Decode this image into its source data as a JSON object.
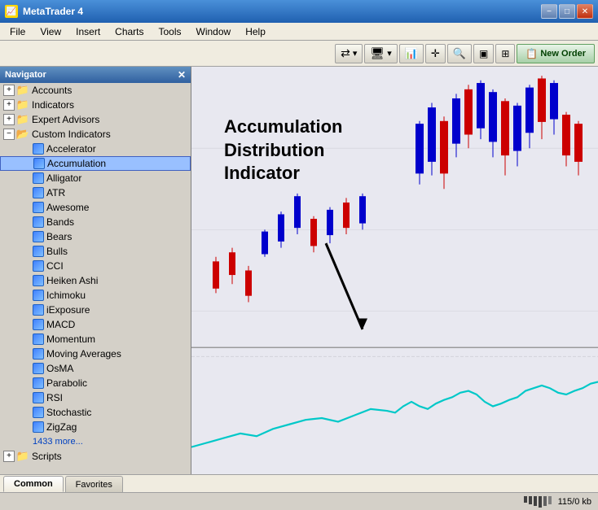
{
  "titleBar": {
    "title": "MetaTrader 4",
    "icon": "📈",
    "buttons": {
      "minimize": "−",
      "maximize": "□",
      "close": "✕"
    }
  },
  "menuBar": {
    "items": [
      "File",
      "View",
      "Insert",
      "Charts",
      "Tools",
      "Window",
      "Help"
    ]
  },
  "toolbar": {
    "newOrderLabel": "New Order"
  },
  "navigator": {
    "title": "Navigator",
    "closeBtn": "✕",
    "tree": {
      "accounts": "Accounts",
      "indicators": "Indicators",
      "expertAdvisors": "Expert Advisors",
      "customIndicators": "Custom Indicators",
      "items": [
        "Accelerator",
        "Accumulation",
        "Alligator",
        "ATR",
        "Awesome",
        "Bands",
        "Bears",
        "Bulls",
        "CCI",
        "Heiken Ashi",
        "Ichimoku",
        "iExposure",
        "MACD",
        "Momentum",
        "Moving Averages",
        "OsMA",
        "Parabolic",
        "RSI",
        "Stochastic",
        "ZigZag",
        "1433 more..."
      ],
      "scripts": "Scripts"
    }
  },
  "annotation": {
    "line1": "Accumulation",
    "line2": "Distribution",
    "line3": "Indicator"
  },
  "tabs": {
    "common": "Common",
    "favorites": "Favorites"
  },
  "statusBar": {
    "fileSize": "115/0 kb"
  },
  "colors": {
    "chartBg": "#f5f5f5",
    "candleUp": "#0000ff",
    "candleDown": "#ff0000",
    "indicatorLine": "#00c8c8",
    "annotationText": "#000000"
  }
}
